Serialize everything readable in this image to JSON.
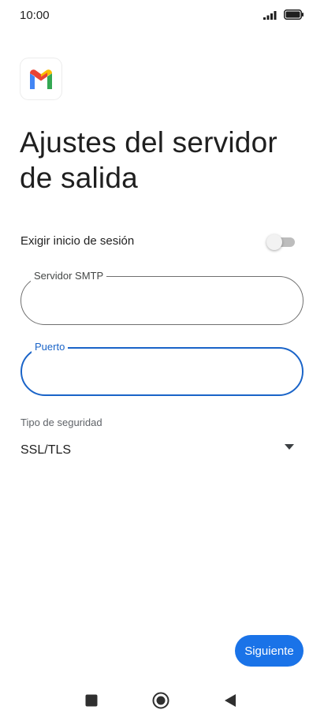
{
  "status_bar": {
    "time": "10:00",
    "icons": [
      "signal-icon",
      "battery-icon"
    ]
  },
  "app": {
    "logo": "gmail-logo-icon"
  },
  "page": {
    "title": "Ajustes del servidor de salida"
  },
  "login_toggle": {
    "label": "Exigir inicio de sesión",
    "enabled": false
  },
  "fields": {
    "smtp": {
      "label": "Servidor SMTP",
      "value": ""
    },
    "port": {
      "label": "Puerto",
      "value": "",
      "focused": true
    }
  },
  "security": {
    "label": "Tipo de seguridad",
    "selected": "SSL/TLS"
  },
  "actions": {
    "next_label": "Siguiente"
  },
  "colors": {
    "accent": "#1a73e8",
    "focus": "#1a64c8",
    "gmail_red": "#ea4335",
    "gmail_blue": "#4285f4",
    "gmail_green": "#34a853",
    "gmail_yellow": "#fbbc04"
  },
  "nav_bar": {
    "icons": [
      "recents-icon",
      "home-icon",
      "back-icon"
    ]
  }
}
